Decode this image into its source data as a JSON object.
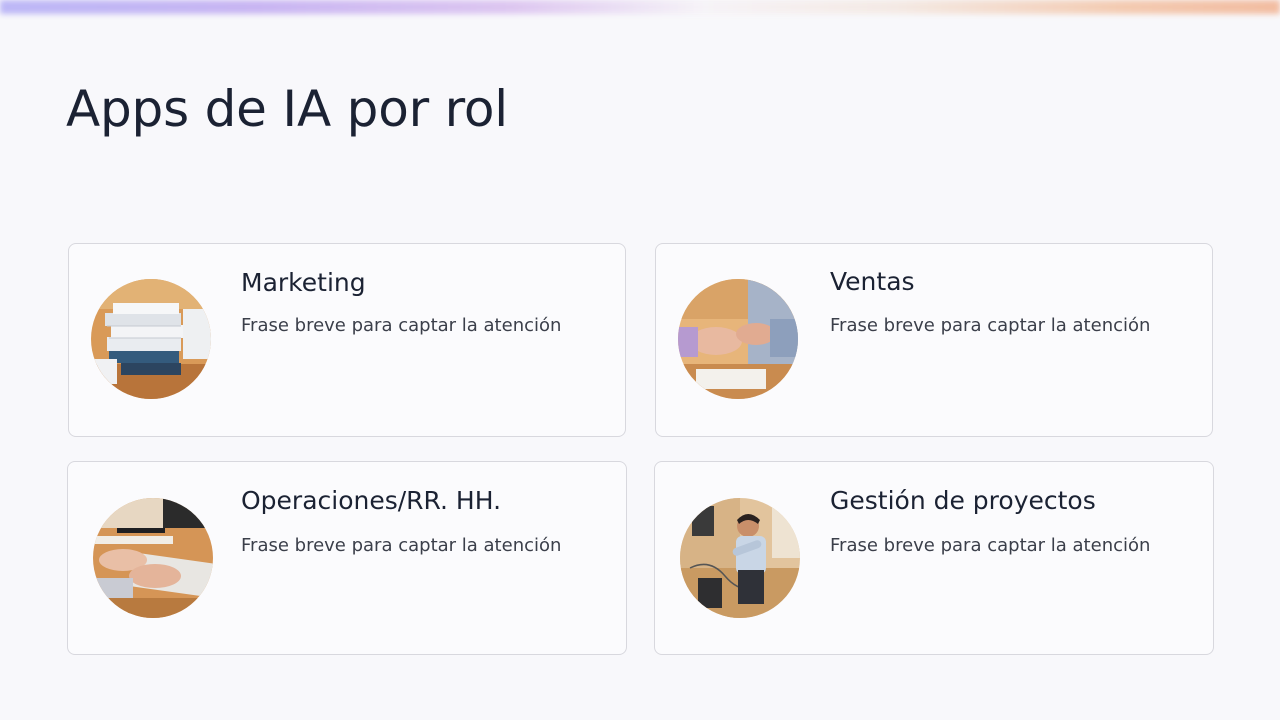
{
  "slide": {
    "title": "Apps de IA por rol"
  },
  "cards": [
    {
      "title": "Marketing",
      "text": "Frase breve para captar la atención",
      "image": "stacked-documents-photo"
    },
    {
      "title": "Ventas",
      "text": "Frase breve para captar la atención",
      "image": "handshake-meeting-photo"
    },
    {
      "title": "Operaciones/RR. HH.",
      "text": "Frase breve para captar la atención",
      "image": "typing-keyboard-photo"
    },
    {
      "title": "Gestión de proyectos",
      "text": "Frase breve para captar la atención",
      "image": "office-worker-computer-photo"
    }
  ],
  "colors": {
    "background": "#f8f8fb",
    "card_border": "#d8d8de",
    "title_text": "#1b2233",
    "body_text": "#3b3f4a",
    "gradient_left": "#b9b4f6",
    "gradient_right": "#f2b99c"
  }
}
